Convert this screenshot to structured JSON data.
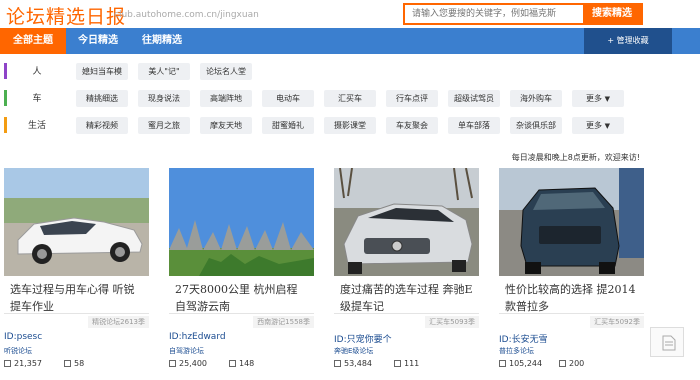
{
  "header": {
    "logo": "论坛精选日报",
    "url": "club.autohome.com.cn/jingxuan",
    "search_placeholder": "请输入您要搜的关键字，例如福克斯",
    "search_button": "搜索精选"
  },
  "nav": {
    "tabs": [
      "全部主题",
      "今日精选",
      "往期精选"
    ],
    "manage": "+ 管理收藏"
  },
  "categories": [
    {
      "label": "人",
      "color": "#8e44c8",
      "items": [
        "媳妇当车模",
        "美人\"记\"",
        "论坛名人堂"
      ]
    },
    {
      "label": "车",
      "color": "#4caf50",
      "items": [
        "精挑细选",
        "现身说法",
        "高端阵地",
        "电动车",
        "汇买车",
        "行车点评",
        "超级试驾员",
        "海外购车"
      ],
      "more": "更多"
    },
    {
      "label": "生活",
      "color": "#f39c12",
      "items": [
        "精彩视频",
        "蜜月之旅",
        "摩友天地",
        "甜蜜婚礼",
        "摄影课堂",
        "车友聚会",
        "单车部落",
        "杂谈俱乐部"
      ],
      "more": "更多"
    }
  ],
  "update_note": "每日凌晨和晚上8点更新，欢迎来访!",
  "cards": [
    {
      "title": "选车过程与用车心得 听锐提车作业",
      "source": "精锐论坛2613季",
      "user": "ID:psesc",
      "forum": "听锐论坛",
      "views": "21,357",
      "replies": "58"
    },
    {
      "title": "27天8000公里 杭州启程自驾游云南",
      "source": "西南游记1558季",
      "user": "ID:hzEdward",
      "forum": "自驾游论坛",
      "views": "25,400",
      "replies": "148"
    },
    {
      "title": "度过痛苦的选车过程 奔驰E级提车记",
      "source": "汇买车5093季",
      "user": "ID:只宠你要个",
      "forum": "奔驰E级论坛",
      "views": "53,484",
      "replies": "111"
    },
    {
      "title": "性价比较高的选择 提2014款普拉多",
      "source": "汇买车5092季",
      "user": "ID:长安无雪",
      "forum": "普拉多论坛",
      "views": "105,244",
      "replies": "200"
    }
  ]
}
